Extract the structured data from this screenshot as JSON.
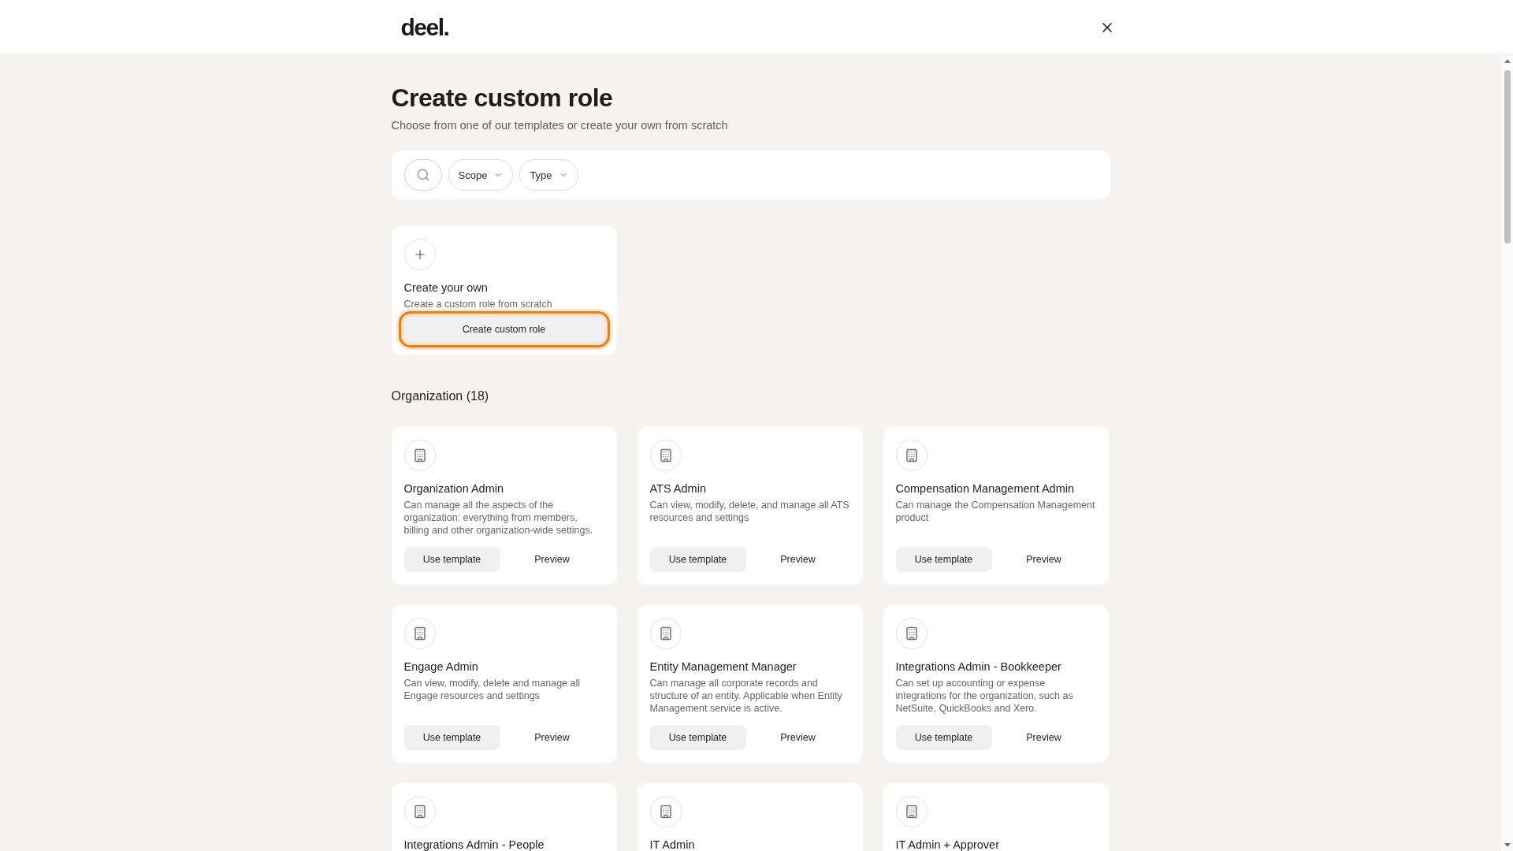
{
  "header": {
    "logo": "deel."
  },
  "page": {
    "title": "Create custom role",
    "subtitle": "Choose from one of our templates or create your own from scratch"
  },
  "filters": [
    {
      "label": "Scope"
    },
    {
      "label": "Type"
    }
  ],
  "create_card": {
    "title": "Create your own",
    "description": "Create a custom role from scratch",
    "button": {
      "label": "Create custom role",
      "focused": true
    }
  },
  "section": {
    "title": "Organization (18)"
  },
  "templates": [
    {
      "title": "Organization Admin",
      "description": "Can manage all the aspects of the organization: everything from members, billing and other organization-wide settings.",
      "use": "Use template",
      "preview": "Preview"
    },
    {
      "title": "ATS Admin",
      "description": "Can view, modify, delete, and manage all ATS resources and settings",
      "use": "Use template",
      "preview": "Preview"
    },
    {
      "title": "Compensation Management Admin",
      "description": "Can manage the Compensation Management product",
      "use": "Use template",
      "preview": "Preview"
    },
    {
      "title": "Engage Admin",
      "description": "Can view, modify, delete and manage all Engage resources and settings",
      "use": "Use template",
      "preview": "Preview"
    },
    {
      "title": "Entity Management Manager",
      "description": "Can manage all corporate records and structure of an entity. Applicable when Entity Management service is active.",
      "use": "Use template",
      "preview": "Preview"
    },
    {
      "title": "Integrations Admin - Bookkeeper",
      "description": "Can set up accounting or expense integrations for the organization, such as NetSuite, QuickBooks and Xero.",
      "use": "Use template",
      "preview": "Preview"
    },
    {
      "title": "Integrations Admin - People"
    },
    {
      "title": "IT Admin"
    },
    {
      "title": "IT Admin + Approver"
    }
  ]
}
